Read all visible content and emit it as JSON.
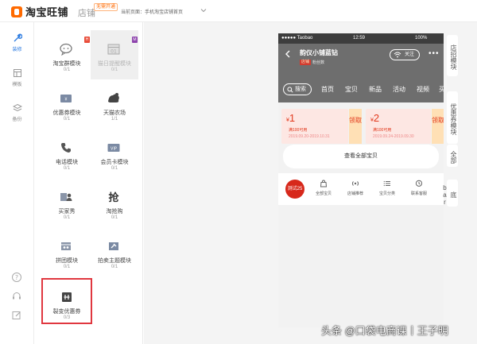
{
  "header": {
    "app_title": "淘宝旺铺",
    "shop_tab": "店铺",
    "shop_badge": "无需开通",
    "current_page": "当前页面：手机淘宝店铺首页",
    "logo_icon": "taobao-logo-icon"
  },
  "rail": {
    "items": [
      {
        "label": "装修",
        "icon": "wrench-icon",
        "active": true
      },
      {
        "label": "模板",
        "icon": "template-icon",
        "active": false
      },
      {
        "label": "备份",
        "icon": "layers-icon",
        "active": false
      }
    ],
    "bottom_icons": [
      "help-icon",
      "headset-icon",
      "edit-icon"
    ],
    "active_color": "#2f7de1"
  },
  "modules": [
    {
      "name": "淘宝群模块",
      "count": "0/1",
      "icon": "chat-group-icon",
      "badge": "H"
    },
    {
      "name": "猫日提醒模块",
      "count": "0/1",
      "icon": "calendar-icon",
      "badge": "M",
      "selected": true
    },
    {
      "name": "优惠券模块",
      "count": "0/1",
      "icon": "coupon-icon"
    },
    {
      "name": "天猫农场",
      "count": "1/1",
      "icon": "farm-icon"
    },
    {
      "name": "电话模块",
      "count": "0/1",
      "icon": "phone-icon"
    },
    {
      "name": "会员卡模块",
      "count": "0/1",
      "icon": "vip-card-icon",
      "icon_text": "VIP"
    },
    {
      "name": "买家秀",
      "count": "0/1",
      "icon": "buyer-show-icon"
    },
    {
      "name": "淘抢购",
      "count": "0/1",
      "icon": "flash-sale-icon",
      "icon_text": "抢"
    },
    {
      "name": "拼团模块",
      "count": "0/1",
      "icon": "group-buy-icon"
    },
    {
      "name": "拍卖主题模块",
      "count": "0/1",
      "icon": "auction-icon"
    },
    {
      "name": "裂变优惠券",
      "count": "0/3",
      "icon": "fission-coupon-icon",
      "highlight": true
    }
  ],
  "phone": {
    "status": {
      "carrier": "●●●●● Taobao",
      "time": "12:59",
      "battery": "100%"
    },
    "shop": {
      "name": "韵仪小铺蓝钻",
      "level": "店铺",
      "level2": "粉丝数"
    },
    "follow_label": "关注",
    "nav": {
      "search": "搜索",
      "items": [
        "首页",
        "宝贝",
        "新品",
        "活动",
        "视频",
        "买"
      ]
    },
    "coupons": [
      {
        "amount": "1",
        "currency": "¥",
        "condition": "满100可用",
        "date": "2019.09.20-2019.10.31",
        "button": "领取"
      },
      {
        "amount": "2",
        "currency": "¥",
        "condition": "满100可用",
        "date": "2019.09.24-2019.09.30",
        "button": "领取"
      }
    ],
    "all_items_button": "查看全部宝贝",
    "tabbar": {
      "promo": "测试25",
      "items": [
        {
          "label": "全部宝贝",
          "icon": "bag-icon"
        },
        {
          "label": "店铺推荐",
          "icon": "broadcast-icon"
        },
        {
          "label": "宝贝分类",
          "icon": "list-icon"
        },
        {
          "label": "联系客服",
          "icon": "chat-icon"
        }
      ]
    }
  },
  "right_tabs": [
    "店招模块",
    "优惠券模块",
    "全部",
    "底bar"
  ],
  "watermark": "头条 @口袋电商课丨王子明",
  "colors": {
    "brand_orange": "#ff6a00",
    "highlight_red": "#e0373f",
    "coupon_red": "#e23a1e",
    "promo_red": "#d7281b"
  }
}
